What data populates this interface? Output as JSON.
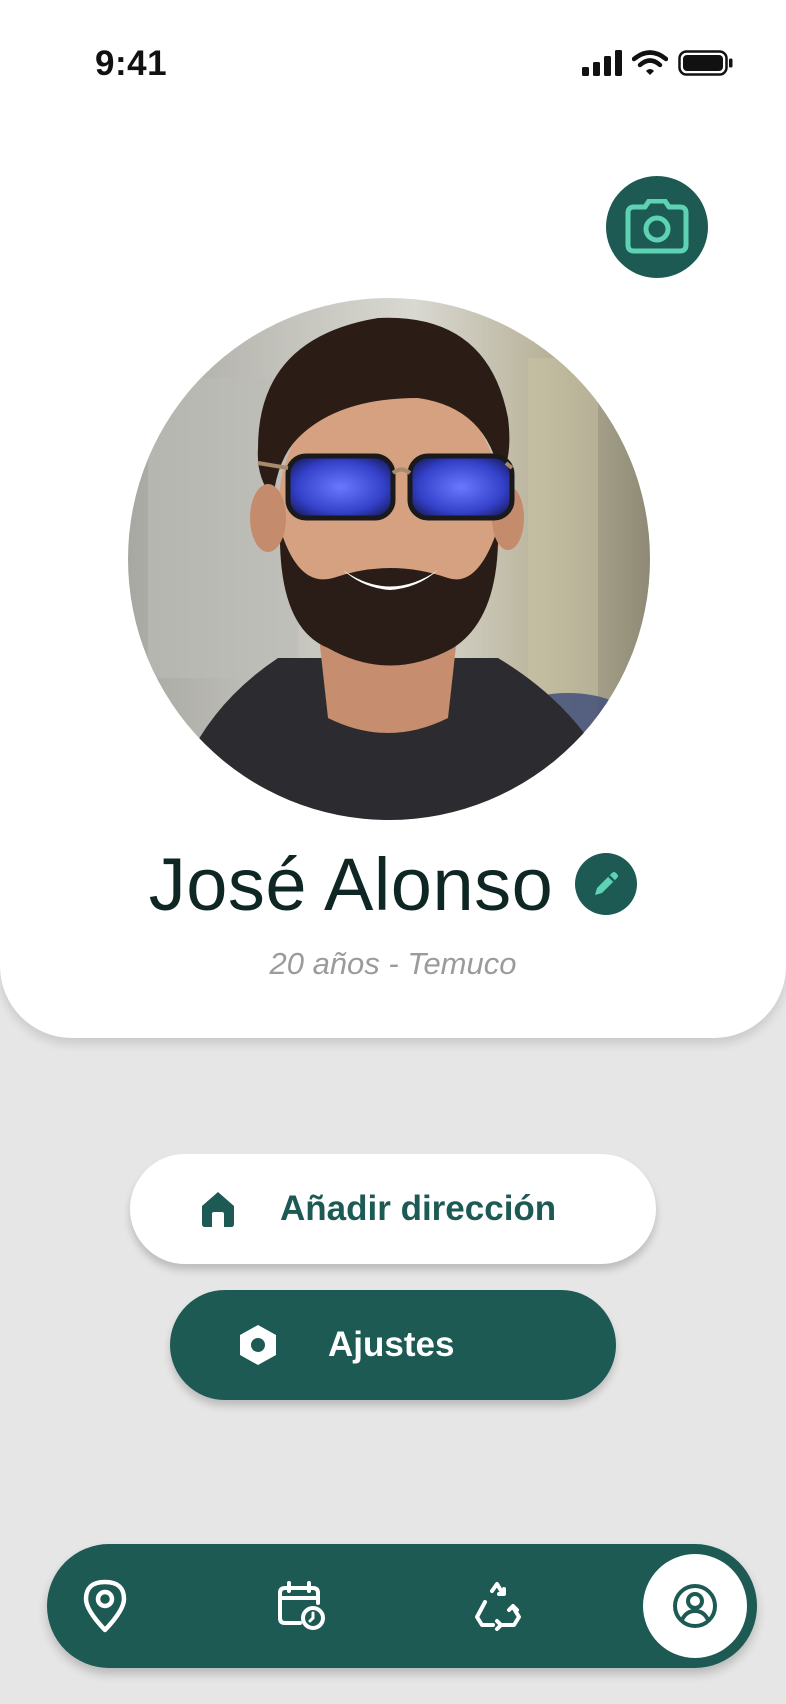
{
  "status_bar": {
    "time": "9:41"
  },
  "profile": {
    "name": "José Alonso",
    "subtitle": "20 años - Temuco"
  },
  "actions": {
    "add_address_label": "Añadir dirección",
    "settings_label": "Ajustes"
  },
  "icons": {
    "camera": "camera-icon",
    "edit": "pencil-icon",
    "home": "home-icon",
    "settings": "hexagon-settings-icon",
    "nav_map": "map-pin-icon",
    "nav_calendar": "calendar-clock-icon",
    "nav_recycle": "recycle-icon",
    "nav_profile": "user-circle-icon"
  },
  "colors": {
    "primary": "#1d5a53",
    "accent": "#5ed3b3",
    "background": "#e6e6e6",
    "card": "#ffffff",
    "name_text": "#0f2724",
    "subtitle_text": "#9b9b9b"
  },
  "navigation": {
    "active_item": "profile"
  }
}
